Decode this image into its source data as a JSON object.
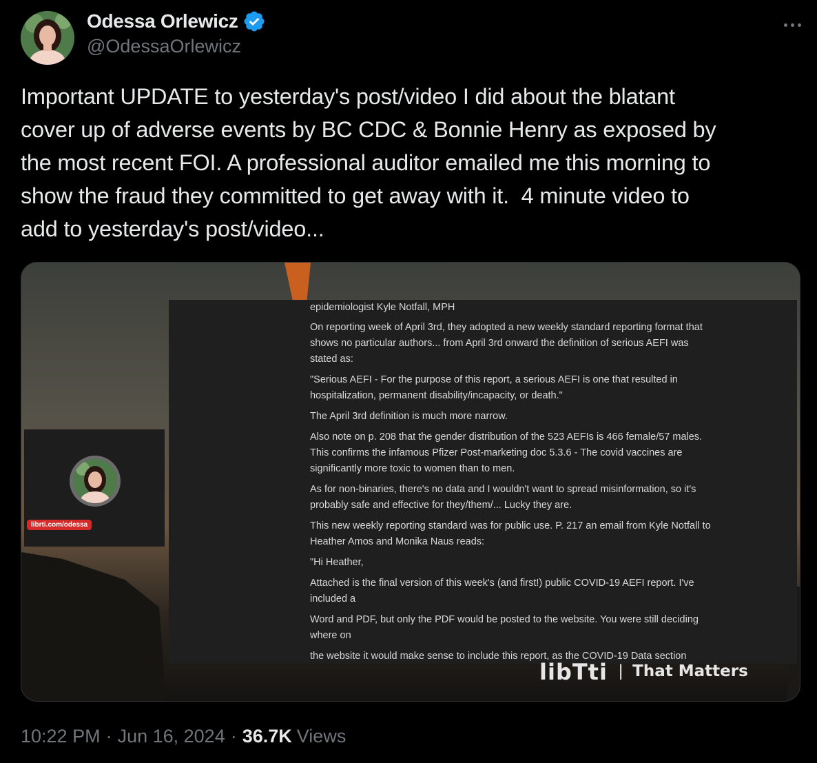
{
  "author": {
    "display_name": "Odessa Orlewicz",
    "handle": "@OdessaOrlewicz",
    "verified": true,
    "verified_color": "#1d9bf0"
  },
  "tweet": {
    "text": "Important UPDATE to yesterday's post/video I did about the blatant\ncover up of adverse events by BC CDC & Bonnie Henry as exposed by\nthe most recent FOI. A professional auditor emailed me this morning to\nshow the fraud they committed to get away with it.  4 minute video to\nadd to yesterday's post/video..."
  },
  "media": {
    "pip_link": "librti.com/odessa",
    "watermark_logo": "libTti",
    "watermark_tagline": "That Matters",
    "document_paragraphs": [
      "epidemiologist Kyle Notfall, MPH",
      "On reporting week of April 3rd, they adopted a new weekly standard reporting format that shows no particular authors... from April 3rd onward the definition of serious AEFI was stated as:",
      "\"Serious AEFI - For the purpose of this report, a serious AEFI is one that resulted in hospitalization, permanent disability/incapacity, or death.\"",
      "The April 3rd definition is much more narrow.",
      "Also note on p. 208 that the gender distribution of the 523 AEFIs is 466 female/57 males. This confirms the infamous Pfizer Post-marketing doc 5.3.6 - The covid vaccines are significantly more toxic to women than to men.",
      "As for non-binaries, there's no data and I wouldn't want to spread misinformation, so it's probably safe and effective for they/them/... Lucky they are.",
      "This new weekly reporting standard was for public use. P. 217 an email from Kyle Notfall to Heather Amos and Monika Naus reads:",
      "\"Hi Heather,",
      "Attached is the final version of this week's (and first!) public COVID-19 AEFI report. I've included a",
      "Word and PDF, but only the PDF would be posted to the website. You were still deciding where on",
      "the website it would make sense to include this report, as the COVID-19 Data section"
    ]
  },
  "meta": {
    "time": "10:22 PM",
    "date": "Jun 16, 2024",
    "separator": "·",
    "views_count": "36.7K",
    "views_label": "Views"
  }
}
